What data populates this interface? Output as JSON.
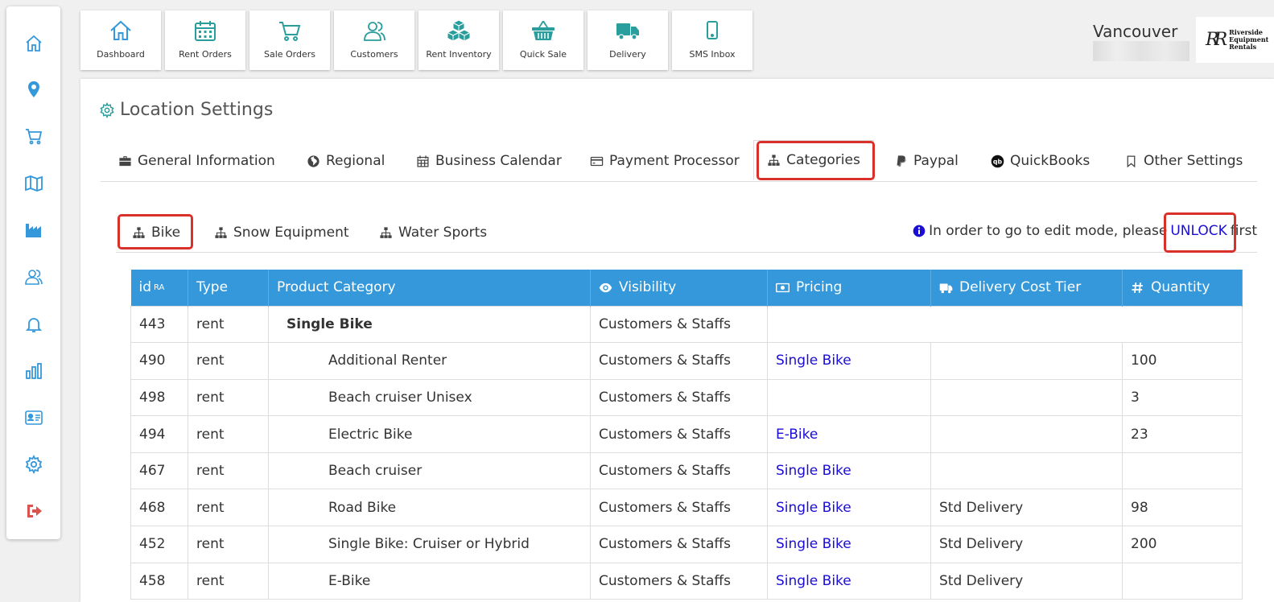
{
  "topnav": [
    {
      "label": "Dashboard",
      "icon": "home-icon"
    },
    {
      "label": "Rent Orders",
      "icon": "calendar-icon"
    },
    {
      "label": "Sale Orders",
      "icon": "cart-icon"
    },
    {
      "label": "Customers",
      "icon": "users-icon"
    },
    {
      "label": "Rent Inventory",
      "icon": "cubes-icon"
    },
    {
      "label": "Quick Sale",
      "icon": "basket-icon"
    },
    {
      "label": "Delivery",
      "icon": "truck-icon"
    },
    {
      "label": "SMS Inbox",
      "icon": "mobile-icon"
    }
  ],
  "header": {
    "location": "Vancouver",
    "logo_text": [
      "Riverside",
      "Equipment",
      "Rentals"
    ]
  },
  "page": {
    "title": "Location Settings"
  },
  "tabs": [
    "General Information",
    "Regional",
    "Business Calendar",
    "Payment Processor",
    "Categories",
    "Paypal",
    "QuickBooks",
    "Other Settings"
  ],
  "subtabs": [
    "Bike",
    "Snow Equipment",
    "Water Sports"
  ],
  "notice": {
    "before": "In order to go to edit mode, please",
    "link": "UNLOCK",
    "after": "first"
  },
  "table": {
    "headers": {
      "id": "id",
      "id_sup": "RA",
      "type": "Type",
      "category": "Product Category",
      "visibility": "Visibility",
      "pricing": "Pricing",
      "delivery": "Delivery Cost Tier",
      "quantity": "Quantity"
    },
    "rows": [
      {
        "id": "443",
        "type": "rent",
        "category": "Single Bike",
        "visibility": "Customers & Staffs",
        "pricing": "",
        "delivery": "",
        "quantity": ""
      },
      {
        "id": "490",
        "type": "rent",
        "category": "Additional Renter",
        "visibility": "Customers & Staffs",
        "pricing": "Single Bike",
        "delivery": "",
        "quantity": "100"
      },
      {
        "id": "498",
        "type": "rent",
        "category": "Beach cruiser Unisex",
        "visibility": "Customers & Staffs",
        "pricing": "",
        "delivery": "",
        "quantity": "3"
      },
      {
        "id": "494",
        "type": "rent",
        "category": "Electric Bike",
        "visibility": "Customers & Staffs",
        "pricing": "E-Bike",
        "delivery": "",
        "quantity": "23"
      },
      {
        "id": "467",
        "type": "rent",
        "category": "Beach cruiser",
        "visibility": "Customers & Staffs",
        "pricing": "Single Bike",
        "delivery": "",
        "quantity": ""
      },
      {
        "id": "468",
        "type": "rent",
        "category": "Road Bike",
        "visibility": "Customers & Staffs",
        "pricing": "Single Bike",
        "delivery": "Std Delivery",
        "quantity": "98"
      },
      {
        "id": "452",
        "type": "rent",
        "category": "Single Bike: Cruiser or Hybrid",
        "visibility": "Customers & Staffs",
        "pricing": "Single Bike",
        "delivery": "Std Delivery",
        "quantity": "200"
      },
      {
        "id": "458",
        "type": "rent",
        "category": "E-Bike",
        "visibility": "Customers & Staffs",
        "pricing": "Single Bike",
        "delivery": "Std Delivery",
        "quantity": ""
      }
    ]
  },
  "colors": {
    "accent": "#3498db",
    "teal": "#2a9d9d",
    "highlight": "#d9302a",
    "link": "#1a0dd6"
  }
}
